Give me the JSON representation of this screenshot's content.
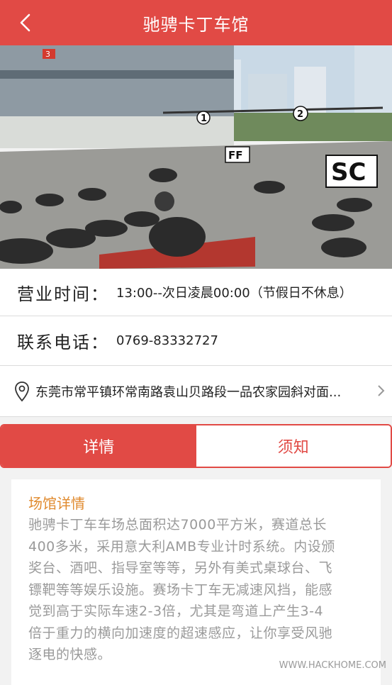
{
  "header": {
    "title": "驰骋卡丁车馆",
    "back_icon": "chevron-left-icon"
  },
  "hero": {
    "alt": "卡丁车场照片",
    "sign_sc": "SC",
    "sign_ff": "FF",
    "gate_1": "1",
    "gate_2": "2",
    "building_num": "3"
  },
  "info": {
    "hours_label": "营业时间：",
    "hours_value": "13:00--次日凌晨00:00（节假日不休息）",
    "phone_label": "联系电话：",
    "phone_value": "0769-83332727",
    "address_icon": "location-pin-icon",
    "address_value": "东莞市常平镇环常南路袁山贝路段一品农家园斜对面...",
    "address_arrow_icon": "chevron-right-icon"
  },
  "tabs": [
    {
      "label": "详情",
      "active": true
    },
    {
      "label": "须知",
      "active": false
    }
  ],
  "detail": {
    "title": "场馆详情",
    "lines": [
      "驰骋卡丁车车场总面积达7000平方米，赛道总长",
      "400多米，采用意大利AMB专业计时系统。内设颁",
      "奖台、酒吧、指导室等等，另外有美式桌球台、飞",
      "镖靶等等娱乐设施。赛场卡丁车无减速风挡，能感",
      "觉到高于实际车速2-3倍，尤其是弯道上产生3-4",
      "倍于重力的横向加速度的超速感应，让你享受风驰",
      "逐电的快感。"
    ]
  },
  "watermark": "WWW.HACKHOME.COM",
  "colors": {
    "brand": "#e14a45",
    "accent_title": "#e08a2e",
    "body_text": "#9a9a9a"
  }
}
